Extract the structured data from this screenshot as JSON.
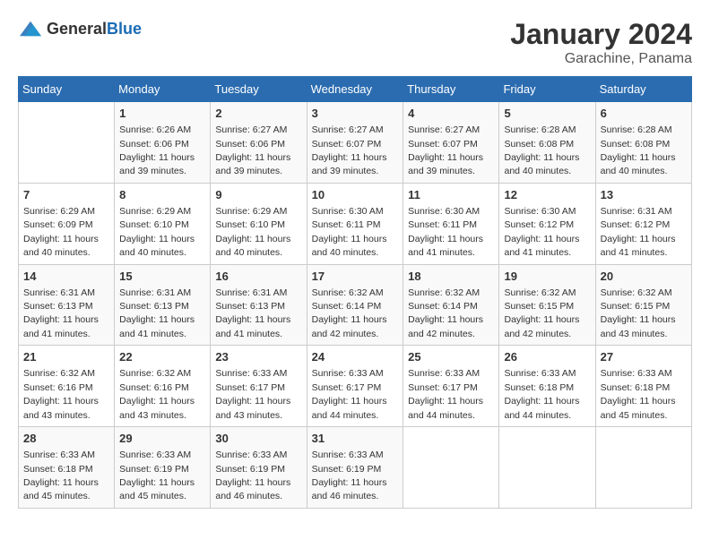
{
  "header": {
    "logo_general": "General",
    "logo_blue": "Blue",
    "month": "January 2024",
    "location": "Garachine, Panama"
  },
  "days_of_week": [
    "Sunday",
    "Monday",
    "Tuesday",
    "Wednesday",
    "Thursday",
    "Friday",
    "Saturday"
  ],
  "weeks": [
    [
      {
        "day": "",
        "info": ""
      },
      {
        "day": "1",
        "info": "Sunrise: 6:26 AM\nSunset: 6:06 PM\nDaylight: 11 hours and 39 minutes."
      },
      {
        "day": "2",
        "info": "Sunrise: 6:27 AM\nSunset: 6:06 PM\nDaylight: 11 hours and 39 minutes."
      },
      {
        "day": "3",
        "info": "Sunrise: 6:27 AM\nSunset: 6:07 PM\nDaylight: 11 hours and 39 minutes."
      },
      {
        "day": "4",
        "info": "Sunrise: 6:27 AM\nSunset: 6:07 PM\nDaylight: 11 hours and 39 minutes."
      },
      {
        "day": "5",
        "info": "Sunrise: 6:28 AM\nSunset: 6:08 PM\nDaylight: 11 hours and 40 minutes."
      },
      {
        "day": "6",
        "info": "Sunrise: 6:28 AM\nSunset: 6:08 PM\nDaylight: 11 hours and 40 minutes."
      }
    ],
    [
      {
        "day": "7",
        "info": "Sunrise: 6:29 AM\nSunset: 6:09 PM\nDaylight: 11 hours and 40 minutes."
      },
      {
        "day": "8",
        "info": "Sunrise: 6:29 AM\nSunset: 6:10 PM\nDaylight: 11 hours and 40 minutes."
      },
      {
        "day": "9",
        "info": "Sunrise: 6:29 AM\nSunset: 6:10 PM\nDaylight: 11 hours and 40 minutes."
      },
      {
        "day": "10",
        "info": "Sunrise: 6:30 AM\nSunset: 6:11 PM\nDaylight: 11 hours and 40 minutes."
      },
      {
        "day": "11",
        "info": "Sunrise: 6:30 AM\nSunset: 6:11 PM\nDaylight: 11 hours and 41 minutes."
      },
      {
        "day": "12",
        "info": "Sunrise: 6:30 AM\nSunset: 6:12 PM\nDaylight: 11 hours and 41 minutes."
      },
      {
        "day": "13",
        "info": "Sunrise: 6:31 AM\nSunset: 6:12 PM\nDaylight: 11 hours and 41 minutes."
      }
    ],
    [
      {
        "day": "14",
        "info": "Sunrise: 6:31 AM\nSunset: 6:13 PM\nDaylight: 11 hours and 41 minutes."
      },
      {
        "day": "15",
        "info": "Sunrise: 6:31 AM\nSunset: 6:13 PM\nDaylight: 11 hours and 41 minutes."
      },
      {
        "day": "16",
        "info": "Sunrise: 6:31 AM\nSunset: 6:13 PM\nDaylight: 11 hours and 41 minutes."
      },
      {
        "day": "17",
        "info": "Sunrise: 6:32 AM\nSunset: 6:14 PM\nDaylight: 11 hours and 42 minutes."
      },
      {
        "day": "18",
        "info": "Sunrise: 6:32 AM\nSunset: 6:14 PM\nDaylight: 11 hours and 42 minutes."
      },
      {
        "day": "19",
        "info": "Sunrise: 6:32 AM\nSunset: 6:15 PM\nDaylight: 11 hours and 42 minutes."
      },
      {
        "day": "20",
        "info": "Sunrise: 6:32 AM\nSunset: 6:15 PM\nDaylight: 11 hours and 43 minutes."
      }
    ],
    [
      {
        "day": "21",
        "info": "Sunrise: 6:32 AM\nSunset: 6:16 PM\nDaylight: 11 hours and 43 minutes."
      },
      {
        "day": "22",
        "info": "Sunrise: 6:32 AM\nSunset: 6:16 PM\nDaylight: 11 hours and 43 minutes."
      },
      {
        "day": "23",
        "info": "Sunrise: 6:33 AM\nSunset: 6:17 PM\nDaylight: 11 hours and 43 minutes."
      },
      {
        "day": "24",
        "info": "Sunrise: 6:33 AM\nSunset: 6:17 PM\nDaylight: 11 hours and 44 minutes."
      },
      {
        "day": "25",
        "info": "Sunrise: 6:33 AM\nSunset: 6:17 PM\nDaylight: 11 hours and 44 minutes."
      },
      {
        "day": "26",
        "info": "Sunrise: 6:33 AM\nSunset: 6:18 PM\nDaylight: 11 hours and 44 minutes."
      },
      {
        "day": "27",
        "info": "Sunrise: 6:33 AM\nSunset: 6:18 PM\nDaylight: 11 hours and 45 minutes."
      }
    ],
    [
      {
        "day": "28",
        "info": "Sunrise: 6:33 AM\nSunset: 6:18 PM\nDaylight: 11 hours and 45 minutes."
      },
      {
        "day": "29",
        "info": "Sunrise: 6:33 AM\nSunset: 6:19 PM\nDaylight: 11 hours and 45 minutes."
      },
      {
        "day": "30",
        "info": "Sunrise: 6:33 AM\nSunset: 6:19 PM\nDaylight: 11 hours and 46 minutes."
      },
      {
        "day": "31",
        "info": "Sunrise: 6:33 AM\nSunset: 6:19 PM\nDaylight: 11 hours and 46 minutes."
      },
      {
        "day": "",
        "info": ""
      },
      {
        "day": "",
        "info": ""
      },
      {
        "day": "",
        "info": ""
      }
    ]
  ]
}
